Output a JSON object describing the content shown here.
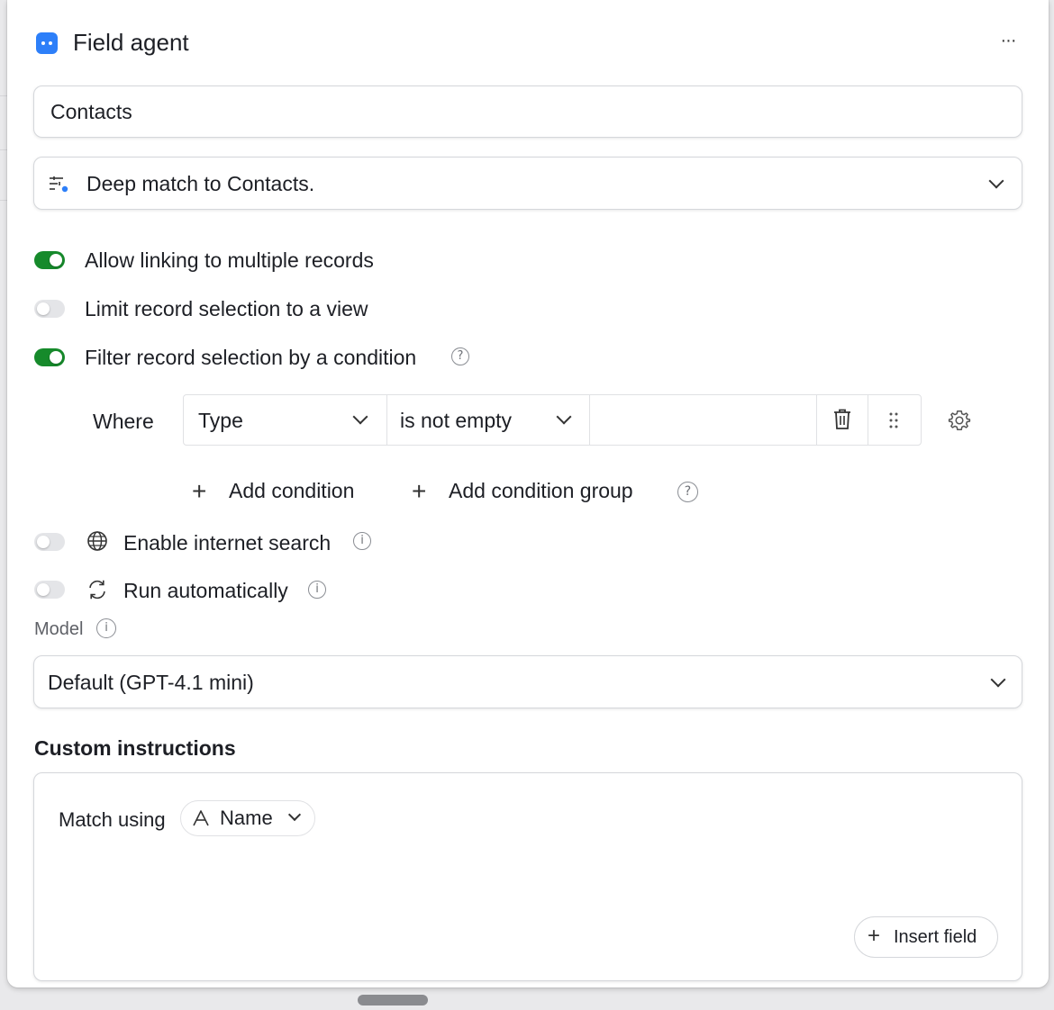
{
  "header": {
    "title": "Field agent",
    "more_label": "···"
  },
  "linked_table": {
    "value": "Contacts"
  },
  "match_mode": {
    "label": "Deep match to Contacts."
  },
  "options": {
    "allow_multiple": {
      "label": "Allow linking to multiple records",
      "enabled": true
    },
    "limit_view": {
      "label": "Limit record selection to a view",
      "enabled": false
    },
    "filter_condition": {
      "label": "Filter record selection by a condition",
      "enabled": true
    }
  },
  "condition": {
    "where_label": "Where",
    "field": "Type",
    "operator": "is not empty",
    "value": ""
  },
  "condition_actions": {
    "add_condition": "Add condition",
    "add_group": "Add condition group"
  },
  "internet_search": {
    "label": "Enable internet search",
    "enabled": false
  },
  "run_automatically": {
    "label": "Run automatically",
    "enabled": false
  },
  "model": {
    "label": "Model",
    "selected": "Default (GPT-4.1 mini)"
  },
  "custom_instructions": {
    "heading": "Custom instructions",
    "text_prefix": "Match using",
    "field_chip": "Name",
    "insert_field": "Insert field"
  },
  "colors": {
    "toggle_on": "#168a2b",
    "toggle_off": "#e4e5e8",
    "accent_blue": "#2d7ff9"
  }
}
